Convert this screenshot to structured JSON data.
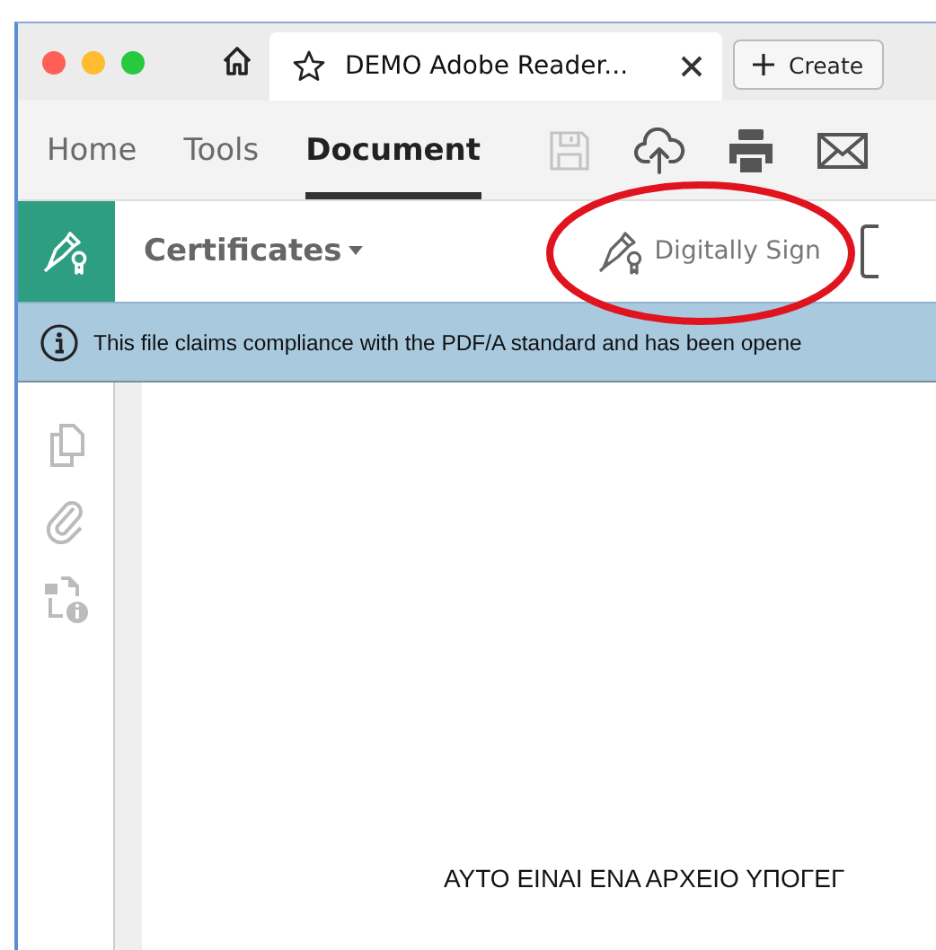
{
  "tab": {
    "title": "DEMO Adobe Reader...",
    "starred": false
  },
  "create_button": {
    "label": "Create"
  },
  "nav_tabs": [
    {
      "label": "Home",
      "selected": false
    },
    {
      "label": "Tools",
      "selected": false
    },
    {
      "label": "Document",
      "selected": true
    }
  ],
  "toolbar_icons": [
    {
      "kind": "save",
      "disabled": true
    },
    {
      "kind": "upload",
      "disabled": false
    },
    {
      "kind": "print",
      "disabled": false
    },
    {
      "kind": "mail",
      "disabled": false
    }
  ],
  "tool_bar": {
    "tool_name": "Certificates",
    "action": "Digitally Sign"
  },
  "info_bar": {
    "message": "This file claims compliance with the PDF/A standard and has been opene"
  },
  "document": {
    "text": "ΑΥΤΟ ΕΙΝΑΙ ΕΝΑ ΑΡΧΕΙΟ ΥΠΟΓΕΓ"
  }
}
